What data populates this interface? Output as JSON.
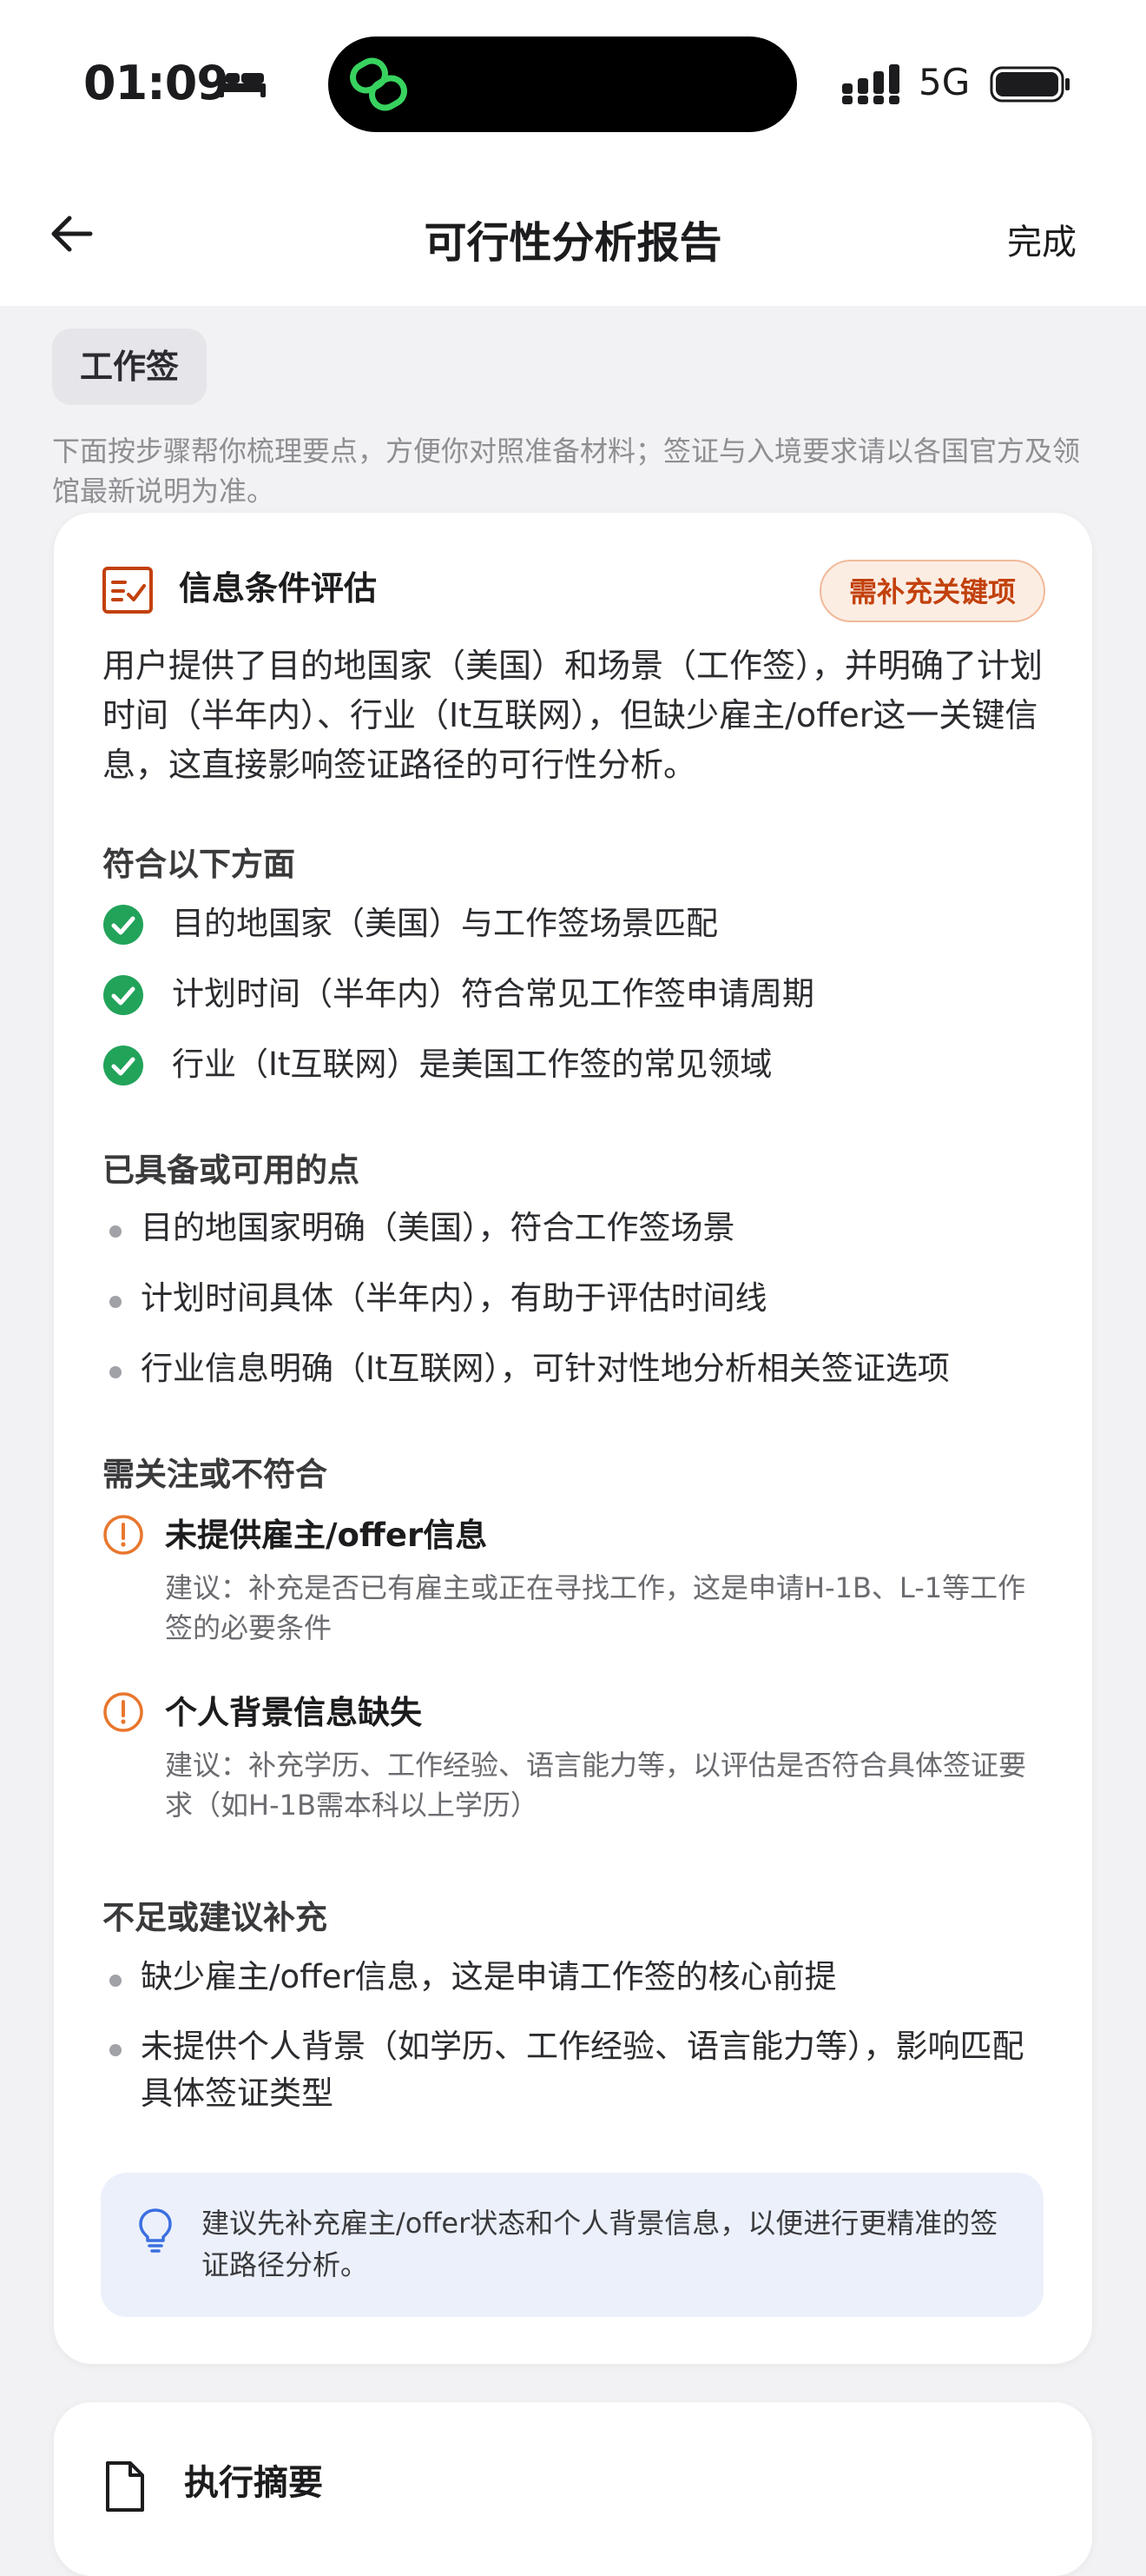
{
  "status_bar": {
    "time": "01:09",
    "network": "5G",
    "icons": [
      "bed-icon",
      "link-icon",
      "signal-icon",
      "battery-icon"
    ]
  },
  "nav": {
    "title": "可行性分析报告",
    "done_label": "完成",
    "back_icon": "arrow-left-icon"
  },
  "tag": "工作签",
  "intro": "下面按步骤帮你梳理要点，方便你对照准备材料；签证与入境要求请以各国官方及领馆最新说明为准。",
  "assessment": {
    "title": "信息条件评估",
    "badge": "需补充关键项",
    "summary": "用户提供了目的地国家（美国）和场景（工作签），并明确了计划时间（半年内）、行业（It互联网），但缺少雇主/offer这一关键信息，这直接影响签证路径的可行性分析。",
    "match": {
      "heading": "符合以下方面",
      "items": [
        "目的地国家（美国）与工作签场景匹配",
        "计划时间（半年内）符合常见工作签申请周期",
        "行业（It互联网）是美国工作签的常见领域"
      ]
    },
    "available": {
      "heading": "已具备或可用的点",
      "items": [
        "目的地国家明确（美国），符合工作签场景",
        "计划时间具体（半年内），有助于评估时间线",
        "行业信息明确（It互联网），可针对性地分析相关签证选项"
      ]
    },
    "attention": {
      "heading": "需关注或不符合",
      "items": [
        {
          "title": "未提供雇主/offer信息",
          "desc": "建议：补充是否已有雇主或正在寻找工作，这是申请H-1B、L-1等工作签的必要条件"
        },
        {
          "title": "个人背景信息缺失",
          "desc": "建议：补充学历、工作经验、语言能力等，以评估是否符合具体签证要求（如H-1B需本科以上学历）"
        }
      ]
    },
    "insufficient": {
      "heading": "不足或建议补充",
      "items": [
        "缺少雇主/offer信息，这是申请工作签的核心前提",
        "未提供个人背景（如学历、工作经验、语言能力等），影响匹配具体签证类型"
      ]
    },
    "tip": "建议先补充雇主/offer状态和个人背景信息，以便进行更精准的签证路径分析。"
  },
  "summary_card": {
    "title": "执行摘要"
  },
  "colors": {
    "check_green": "#22A35A",
    "warn_orange": "#E8772E",
    "badge_text": "#C2410C",
    "tip_bg": "#EBF0FB",
    "tip_icon": "#3B6FE0"
  }
}
